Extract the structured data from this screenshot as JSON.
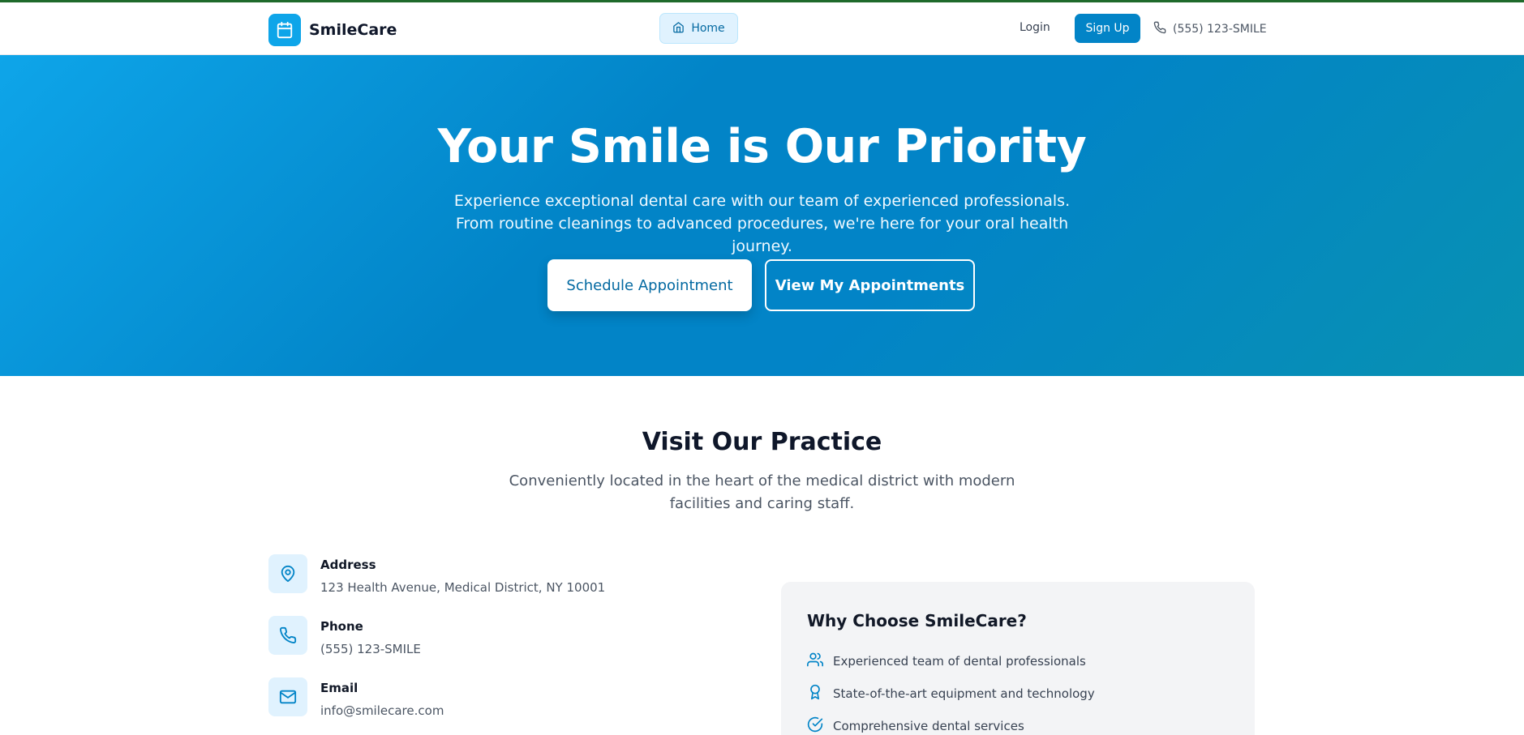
{
  "header": {
    "brand_name": "SmileCare",
    "nav_home": "Home",
    "login": "Login",
    "signup": "Sign Up",
    "phone": "(555) 123-SMILE"
  },
  "hero": {
    "title": "Your Smile is Our Priority",
    "subtitle": "Experience exceptional dental care with our team of experienced professionals. From routine cleanings to advanced procedures, we're here for your oral health journey.",
    "primary_button": "Schedule Appointment",
    "secondary_button": "View My Appointments"
  },
  "practice": {
    "title": "Visit Our Practice",
    "subtitle": "Conveniently located in the heart of the medical district with modern facilities and caring staff.",
    "contacts": [
      {
        "label": "Address",
        "value": "123 Health Avenue, Medical District, NY 10001",
        "icon": "map-pin-icon"
      },
      {
        "label": "Phone",
        "value": "(555) 123-SMILE",
        "icon": "phone-icon"
      },
      {
        "label": "Email",
        "value": "info@smilecare.com",
        "icon": "mail-icon"
      }
    ],
    "why": {
      "title": "Why Choose SmileCare?",
      "items": [
        {
          "text": "Experienced team of dental professionals",
          "icon": "users-icon"
        },
        {
          "text": "State-of-the-art equipment and technology",
          "icon": "award-icon"
        },
        {
          "text": "Comprehensive dental services",
          "icon": "check-circle-icon"
        }
      ]
    }
  },
  "colors": {
    "brand": "#0ea5e9",
    "primary": "#0284c7",
    "text_dark": "#0f172a"
  }
}
